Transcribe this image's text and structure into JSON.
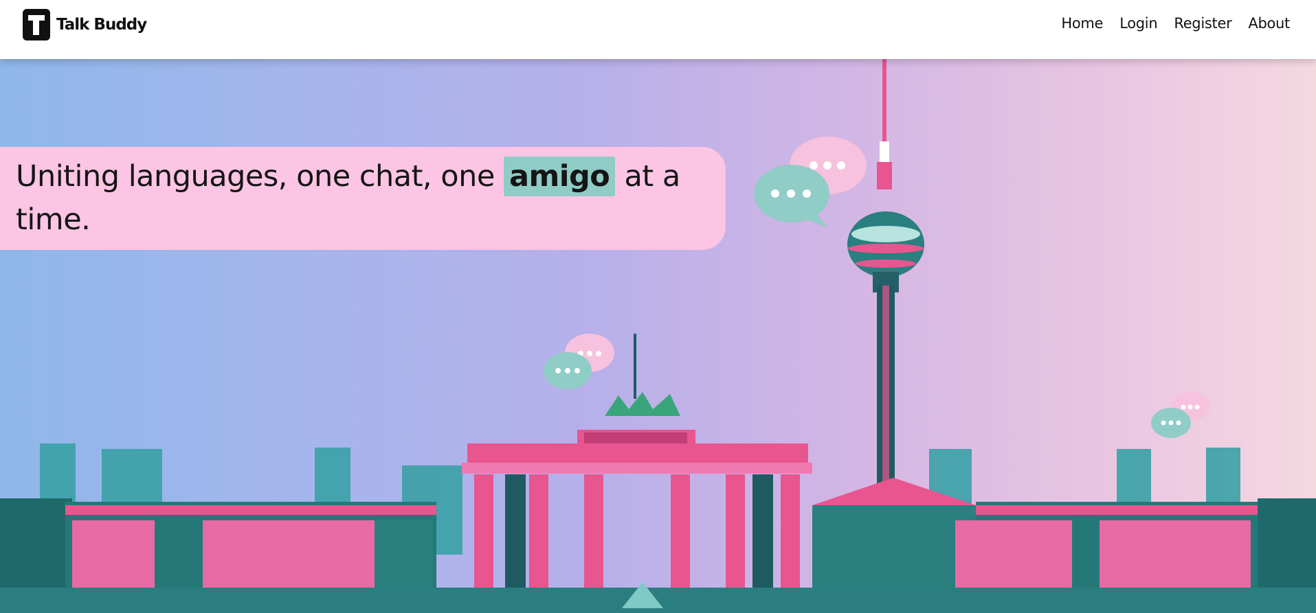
{
  "brand": {
    "name": "Talk Buddy",
    "logo_icon": "t-logo-icon"
  },
  "nav": {
    "items": [
      "Home",
      "Login",
      "Register",
      "About"
    ]
  },
  "hero": {
    "tagline_before": "Uniting languages, one chat, one ",
    "tagline_highlight": "amigo",
    "tagline_after": " at a time.",
    "illustration": "berlin-skyline-illustration"
  },
  "colors": {
    "tagline_bg": "#fcc5e4",
    "highlight_bg": "#8fccc6",
    "accent_pink": "#e8558f",
    "accent_teal": "#2e8a8a"
  }
}
